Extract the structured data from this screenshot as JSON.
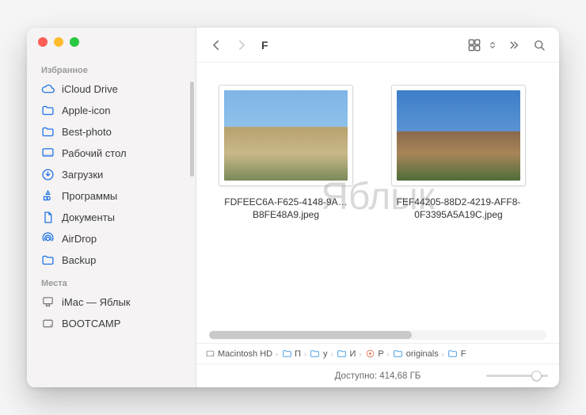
{
  "toolbar": {
    "title": "F"
  },
  "sidebar": {
    "sections": [
      {
        "header": "Избранное",
        "items": [
          {
            "label": "iCloud Drive",
            "icon": "cloud"
          },
          {
            "label": "Apple-icon",
            "icon": "folder"
          },
          {
            "label": "Best-photo",
            "icon": "folder"
          },
          {
            "label": "Рабочий стол",
            "icon": "desktop"
          },
          {
            "label": "Загрузки",
            "icon": "download"
          },
          {
            "label": "Программы",
            "icon": "apps"
          },
          {
            "label": "Документы",
            "icon": "document"
          },
          {
            "label": "AirDrop",
            "icon": "airdrop"
          },
          {
            "label": "Backup",
            "icon": "folder"
          }
        ]
      },
      {
        "header": "Места",
        "items": [
          {
            "label": "iMac — Яблык",
            "icon": "imac"
          },
          {
            "label": "BOOTCAMP",
            "icon": "disk"
          }
        ]
      }
    ]
  },
  "files": [
    {
      "name": "FDFEEC6A-F625-4148-9A…B8FE48A9.jpeg",
      "thumb_css": "linear-gradient(180deg,#7fb5e6 0%,#8fc1ea 40%,#b7a26f 41%,#c9b887 70%,#7a8a5a 100%)"
    },
    {
      "name": "FEF44205-88D2-4219-AFF8-0F3395A5A19C.jpeg",
      "thumb_css": "linear-gradient(180deg,#3d7ec9 0%,#5a93d2 45%,#8a6a4c 46%,#a78559 70%,#4f6d3a 100%)"
    }
  ],
  "pathbar": [
    {
      "label": "Macintosh HD",
      "icon": "disk"
    },
    {
      "label": "П",
      "icon": "folder"
    },
    {
      "label": "y",
      "icon": "folder"
    },
    {
      "label": "И",
      "icon": "folder"
    },
    {
      "label": "P",
      "icon": "photolib"
    },
    {
      "label": "originals",
      "icon": "folder"
    },
    {
      "label": "F",
      "icon": "folder"
    }
  ],
  "status": {
    "text": "Доступно: 414,68 ГБ"
  },
  "watermark": "Яблык"
}
